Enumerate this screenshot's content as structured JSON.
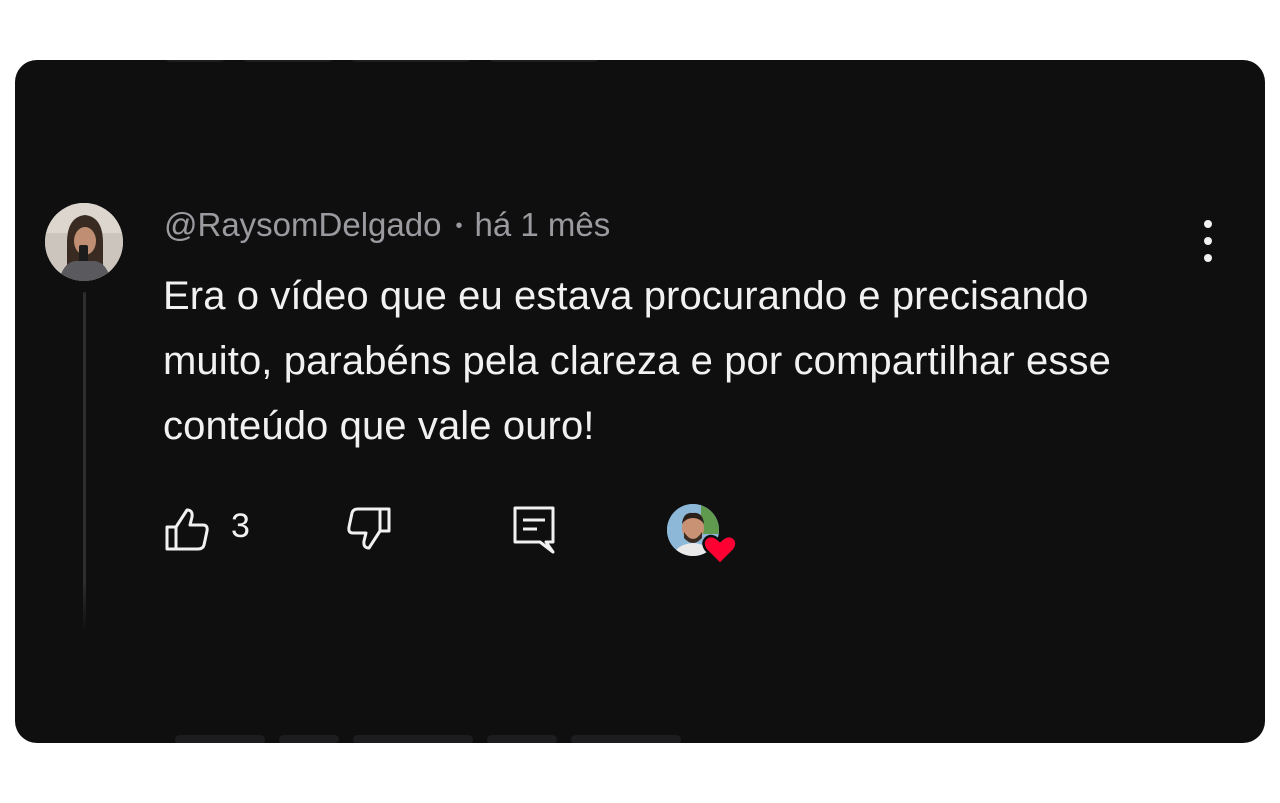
{
  "comment": {
    "author": "@RaysomDelgado",
    "separator": "•",
    "time": "há 1 mês",
    "text": "Era o vídeo que eu estava procurando e precisando muito, parabéns pela clareza e por compartilhar esse conteúdo que vale ouro!",
    "like_count": "3"
  },
  "icons": {
    "more": "more-vert-icon",
    "like": "thumbs-up-icon",
    "dislike": "thumbs-down-icon",
    "reply": "reply-comment-icon",
    "creator_heart": "heart-icon"
  },
  "colors": {
    "background": "#0f0f10",
    "text": "#f1f1f1",
    "meta_text": "#9a9a9f",
    "heart": "#ff0033"
  }
}
